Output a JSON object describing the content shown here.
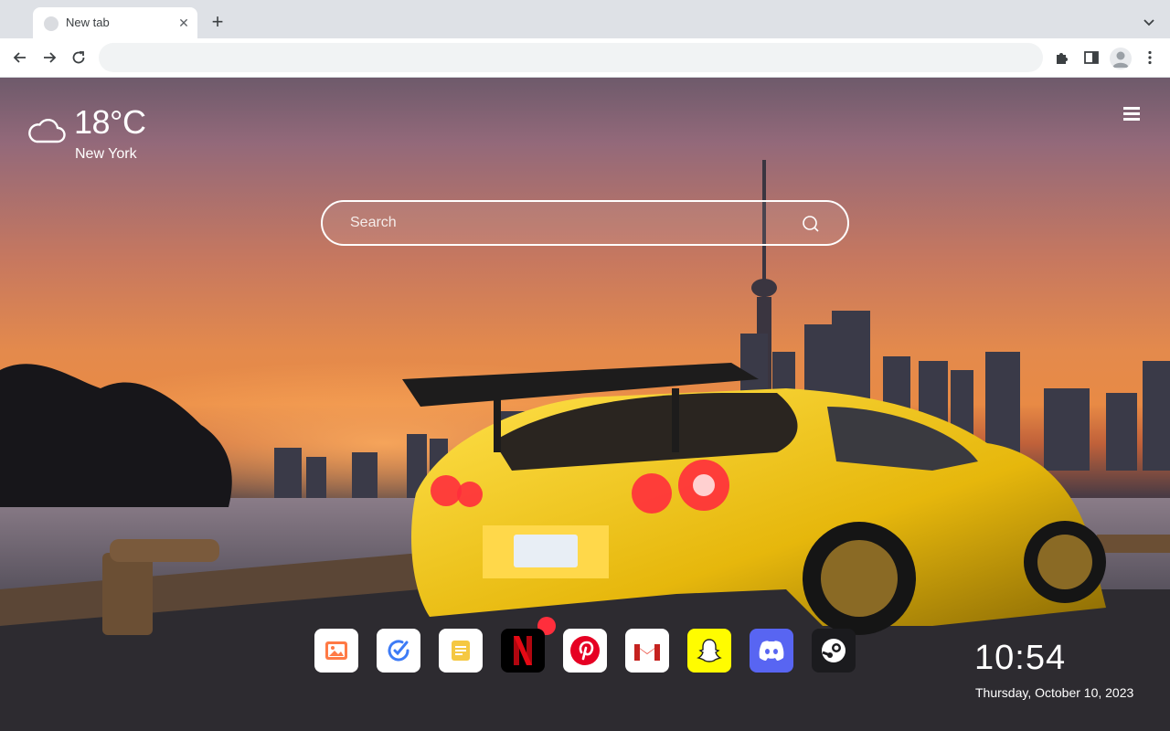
{
  "browser": {
    "tab": {
      "title": "New tab",
      "close_glyph": "✕"
    },
    "new_tab_glyph": "+",
    "omnibox": {
      "value": "",
      "placeholder": ""
    }
  },
  "weather": {
    "temperature": "18°C",
    "city": "New York",
    "icon": "cloud-icon"
  },
  "search": {
    "placeholder": "Search"
  },
  "apps": [
    {
      "name": "gallery",
      "icon": "image-icon",
      "bg": "#ffffff"
    },
    {
      "name": "tasks",
      "icon": "check-circle-icon",
      "bg": "#ffffff"
    },
    {
      "name": "notes",
      "icon": "note-icon",
      "bg": "#ffffff"
    },
    {
      "name": "netflix",
      "icon": "netflix-icon",
      "bg": "#000000"
    },
    {
      "name": "pinterest",
      "icon": "pinterest-icon",
      "bg": "#ffffff"
    },
    {
      "name": "gmail",
      "icon": "gmail-icon",
      "bg": "#ffffff"
    },
    {
      "name": "snapchat",
      "icon": "snapchat-icon",
      "bg": "#fffc00"
    },
    {
      "name": "discord",
      "icon": "discord-icon",
      "bg": "#5865f2"
    },
    {
      "name": "steam",
      "icon": "steam-icon",
      "bg": "#1b1b1e"
    }
  ],
  "clock": {
    "time": "10:54",
    "date": "Thursday, October 10, 2023"
  },
  "colors": {
    "netflix": "#e50914",
    "pinterest": "#e60023",
    "car": "#f2c811"
  }
}
